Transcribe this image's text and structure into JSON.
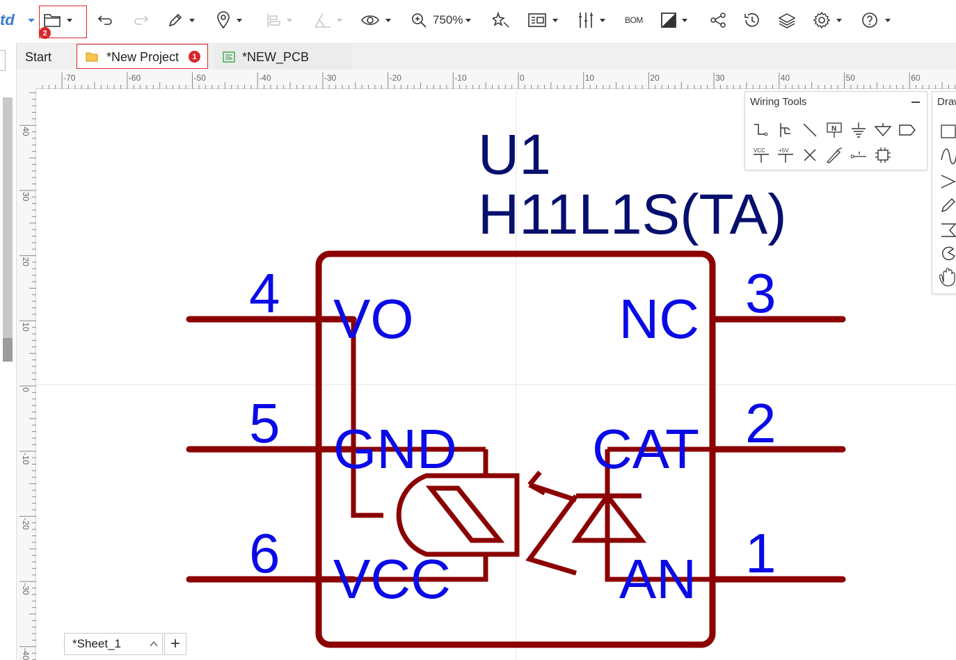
{
  "app": {
    "brand_fragment": "td"
  },
  "toolbar": {
    "zoom_level": "750%",
    "bom_label": "BOM",
    "items": [
      "folder-open",
      "undo",
      "redo",
      "pencil",
      "location-pin",
      "align",
      "measure",
      "eye",
      "zoom",
      "magic-wand",
      "component-library",
      "tools",
      "bom",
      "contrast",
      "share",
      "history",
      "layers",
      "settings",
      "help"
    ]
  },
  "annotations": {
    "badge_1": "1",
    "badge_2": "2"
  },
  "tabs": [
    {
      "label": "Start"
    },
    {
      "label": "*New Project"
    },
    {
      "label": "*NEW_PCB"
    }
  ],
  "ruler": {
    "horizontal_labels": [
      "-70",
      "-60",
      "-50",
      "-40",
      "-30",
      "-20",
      "-10",
      "0",
      "10",
      "20",
      "30",
      "40",
      "50",
      "60"
    ],
    "vertical_labels": [
      "40",
      "30",
      "20",
      "10",
      "0",
      "-10",
      "-20",
      "-30",
      "-40"
    ]
  },
  "wiring_tools": {
    "title": "Wiring Tools",
    "vcc_label": "VCC",
    "plus5v_label": "+5V",
    "net_label_letter": "N"
  },
  "drawing_tools": {
    "title_fragment": "Draw"
  },
  "schematic": {
    "designator": "U1",
    "part_name": "H11L1S(TA)",
    "pins": [
      {
        "number": "4",
        "name": "VO"
      },
      {
        "number": "5",
        "name": "GND"
      },
      {
        "number": "6",
        "name": "VCC"
      },
      {
        "number": "3",
        "name": "NC"
      },
      {
        "number": "2",
        "name": "CAT"
      },
      {
        "number": "1",
        "name": "AN"
      }
    ],
    "colors": {
      "body": "#8b0000",
      "pin_text": "#0a0ae6",
      "title_text": "#07106e"
    }
  },
  "sheet": {
    "label": "*Sheet_1",
    "add_label": "+"
  }
}
